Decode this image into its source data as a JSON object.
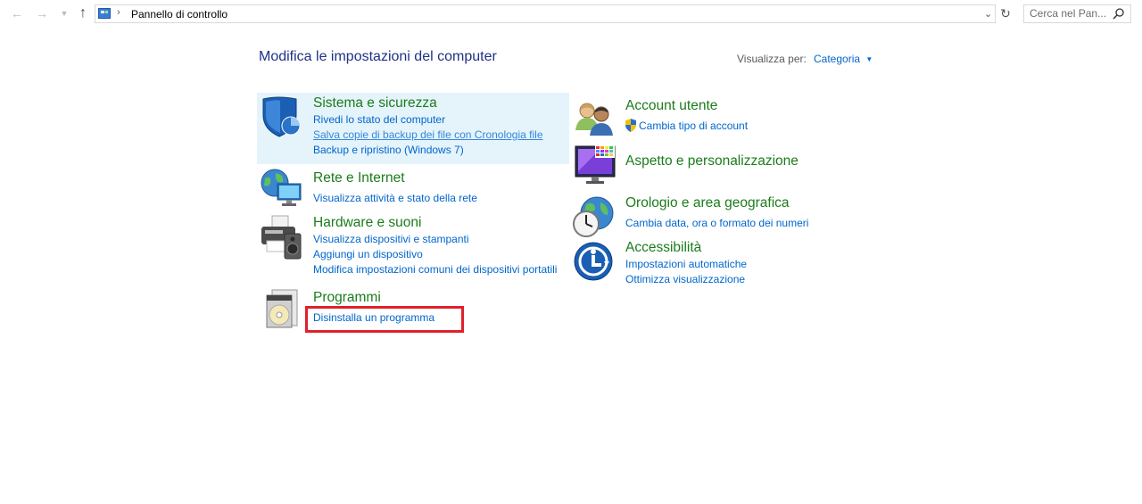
{
  "address_bar": {
    "location": "Pannello di controllo"
  },
  "search": {
    "placeholder": "Cerca nel Pan..."
  },
  "main": {
    "title": "Modifica le impostazioni del computer",
    "view_by_label": "Visualizza per:",
    "view_by_value": "Categoria"
  },
  "categories": [
    {
      "title": "Sistema e sicurezza",
      "links": [
        "Rivedi lo stato del computer",
        "Salva copie di backup dei file con Cronologia file",
        "Backup e ripristino (Windows 7)"
      ]
    },
    {
      "title": "Rete e Internet",
      "links": [
        "Visualizza attività e stato della rete"
      ]
    },
    {
      "title": "Hardware e suoni",
      "links": [
        "Visualizza dispositivi e stampanti",
        "Aggiungi un dispositivo",
        "Modifica impostazioni comuni dei dispositivi portatili"
      ]
    },
    {
      "title": "Programmi",
      "links": [
        "Disinstalla un programma"
      ]
    },
    {
      "title": "Account utente",
      "links": [
        "Cambia tipo di account"
      ]
    },
    {
      "title": "Aspetto e personalizzazione",
      "links": []
    },
    {
      "title": "Orologio e area geografica",
      "links": [
        "Cambia data, ora o formato dei numeri"
      ]
    },
    {
      "title": "Accessibilità",
      "links": [
        "Impostazioni automatiche",
        "Ottimizza visualizzazione"
      ]
    }
  ],
  "colors": {
    "category_title": "#1b7c1b",
    "link": "#0066cc",
    "page_title": "#1e3287",
    "highlight": "#e5f3fb",
    "annotation": "#e0202a"
  }
}
